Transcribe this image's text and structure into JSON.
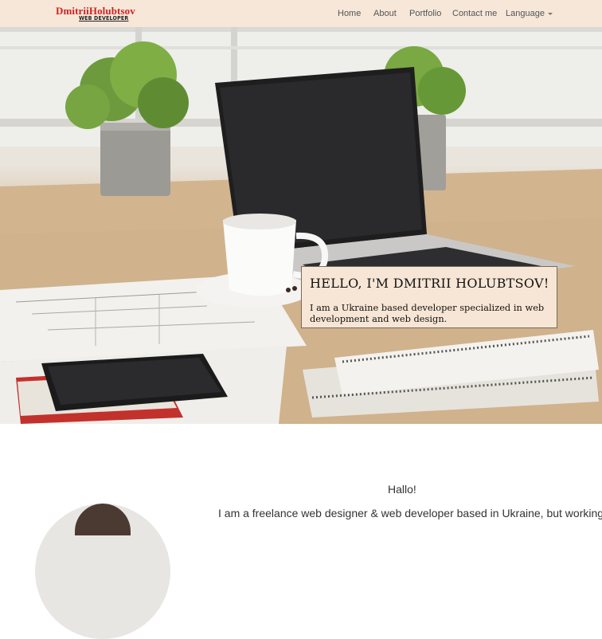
{
  "brand": {
    "name": "DmitriiHolubtsov",
    "subtitle": "WEB DEVELOPER"
  },
  "nav": {
    "items": [
      {
        "label": "Home"
      },
      {
        "label": "About"
      },
      {
        "label": "Portfolio"
      },
      {
        "label": "Contact me"
      },
      {
        "label": "Language"
      }
    ]
  },
  "hero": {
    "title": "HELLO, I'M DMITRII HOLUBTSOV!",
    "text": "I am a Ukraine based developer specialized in web development and web design."
  },
  "about": {
    "greeting": "Hallo!",
    "intro": "I am a freelance web designer & web developer based in Ukraine, but working"
  },
  "colors": {
    "navbar_bg": "#f6e7d8",
    "brand": "#d42020",
    "hero_box_bg": "#f7e6d5"
  }
}
